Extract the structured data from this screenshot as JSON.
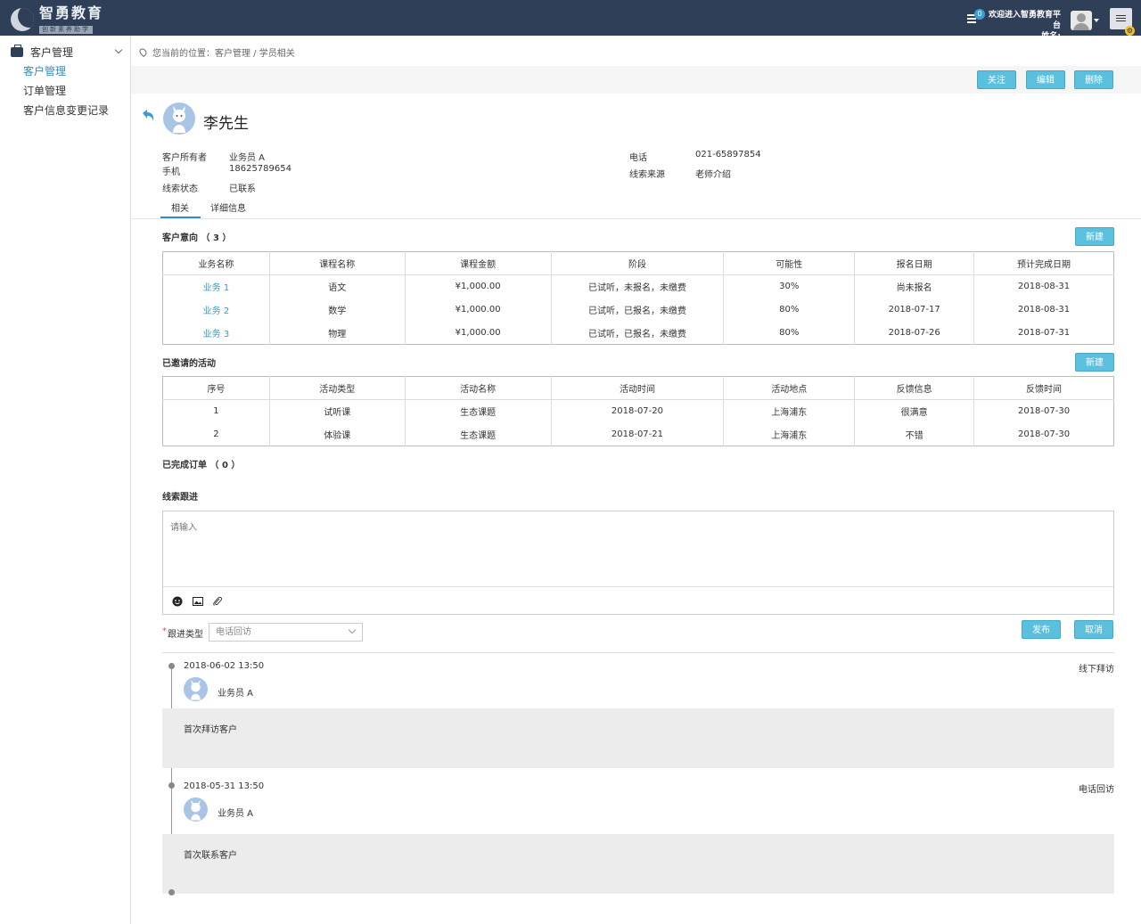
{
  "header": {
    "logo_title": "智勇教育",
    "logo_subtitle": "创新素养助学",
    "message_count": "0",
    "welcome_line1": "欢迎进入智勇教育平台",
    "welcome_line2": "姓名:"
  },
  "sidebar": {
    "group_label": "客户管理",
    "items": [
      {
        "label": "客户管理",
        "active": true
      },
      {
        "label": "订单管理",
        "active": false
      },
      {
        "label": "客户信息变更记录",
        "active": false
      }
    ]
  },
  "breadcrumb": "您当前的位置：客户管理 / 学员相关",
  "actions": {
    "follow": "关注",
    "edit": "编辑",
    "delete": "删除"
  },
  "customer": {
    "name": "李先生",
    "owner_label": "客户所有者",
    "owner_value": "业务员 A",
    "mobile_label": "手机",
    "mobile_value": "18625789654",
    "status_label": "线索状态",
    "status_value": "已联系",
    "phone_label": "电话",
    "phone_value": "021-65897854",
    "source_label": "线索来源",
    "source_value": "老师介绍"
  },
  "tabs": [
    {
      "label": "相关",
      "active": true
    },
    {
      "label": "详细信息",
      "active": false
    }
  ],
  "intent": {
    "title": "客户意向 （ 3 ）",
    "new_label": "新建",
    "columns": [
      "业务名称",
      "课程名称",
      "课程金额",
      "阶段",
      "可能性",
      "报名日期",
      "预计完成日期"
    ],
    "rows": [
      [
        "业务 1",
        "语文",
        "¥1,000.00",
        "已试听，未报名，未缴费",
        "30%",
        "尚未报名",
        "2018-08-31"
      ],
      [
        "业务 2",
        "数学",
        "¥1,000.00",
        "已试听，已报名，未缴费",
        "80%",
        "2018-07-17",
        "2018-08-31"
      ],
      [
        "业务 3",
        "物理",
        "¥1,000.00",
        "已试听，已报名，未缴费",
        "80%",
        "2018-07-26",
        "2018-07-31"
      ]
    ]
  },
  "activities": {
    "title": "已邀请的活动",
    "new_label": "新建",
    "columns": [
      "序号",
      "活动类型",
      "活动名称",
      "活动时间",
      "活动地点",
      "反馈信息",
      "反馈时间"
    ],
    "rows": [
      [
        "1",
        "试听课",
        "生态课题",
        "2018-07-20",
        "上海浦东",
        "很满意",
        "2018-07-30"
      ],
      [
        "2",
        "体验课",
        "生态课题",
        "2018-07-21",
        "上海浦东",
        "不错",
        "2018-07-30"
      ]
    ]
  },
  "orders_title": "已完成订单 （ 0 ）",
  "followup": {
    "title": "线索跟进",
    "placeholder": "请输入",
    "type_label": "跟进类型",
    "type_value": "电话回访",
    "publish": "发布",
    "cancel": "取消"
  },
  "timeline": [
    {
      "time": "2018-06-02 13:50",
      "type": "线下拜访",
      "user": "业务员 A",
      "note": "首次拜访客户"
    },
    {
      "time": "2018-05-31 13:50",
      "type": "电话回访",
      "user": "业务员 A",
      "note": "首次联系客户"
    }
  ],
  "colors": {
    "topbar": "#2f3f58",
    "accent_button": "#5bc0de",
    "link": "#2a9fd6"
  }
}
